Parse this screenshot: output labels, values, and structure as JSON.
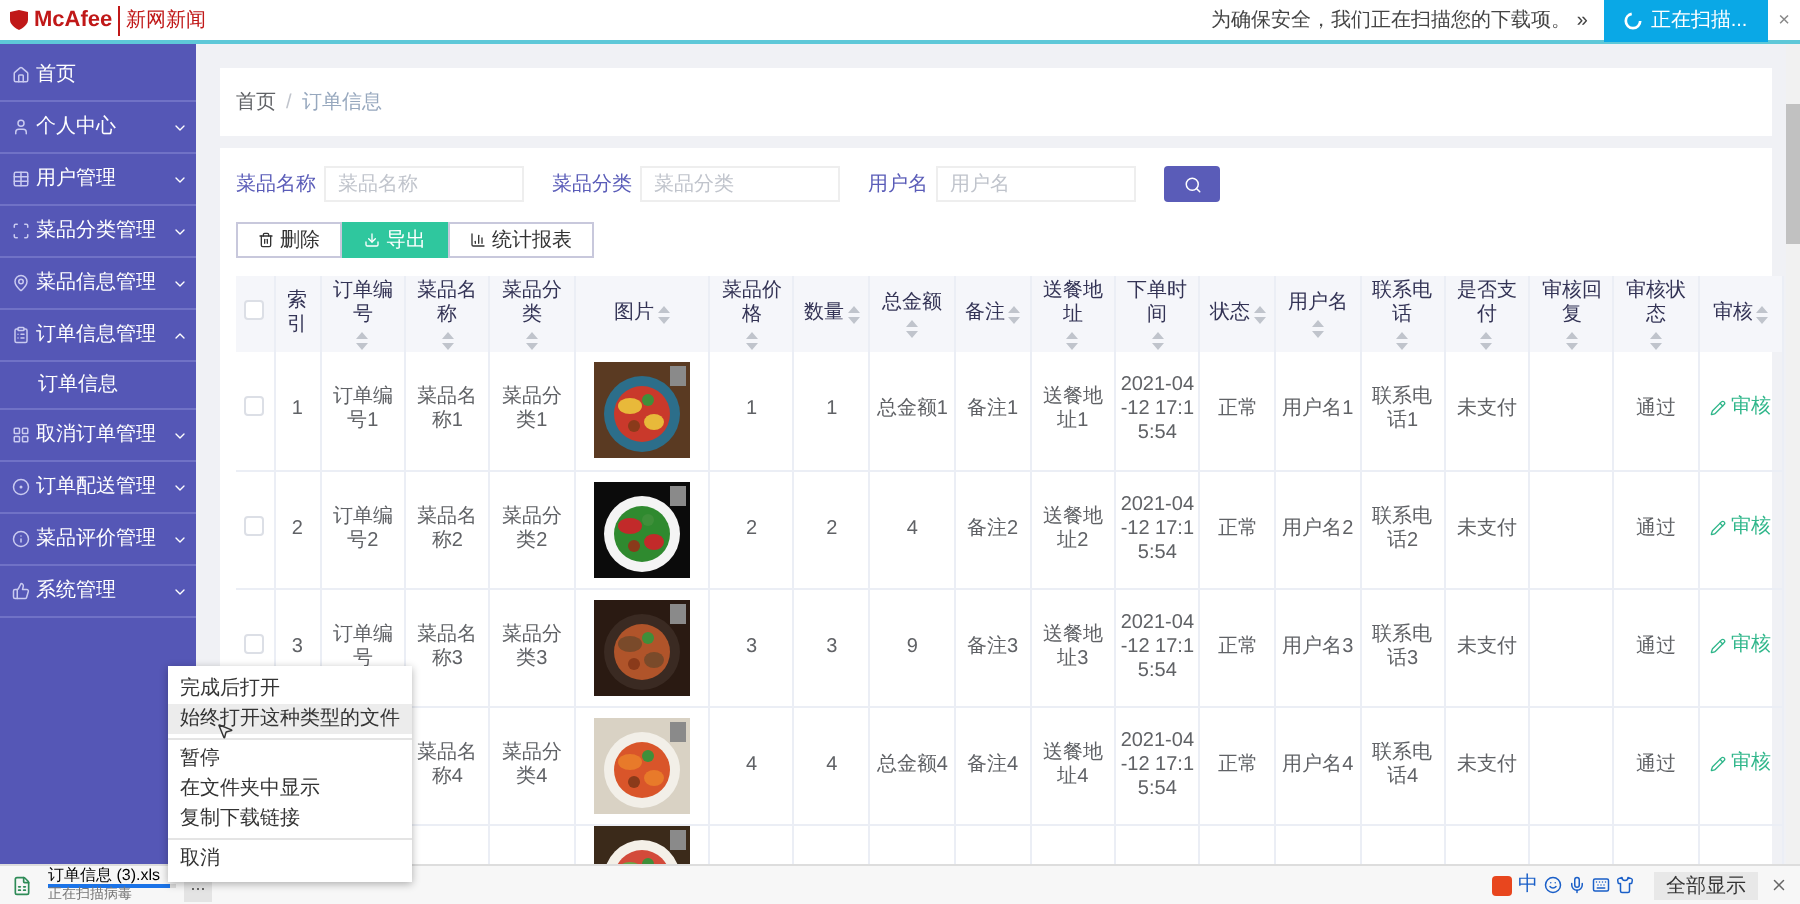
{
  "browser_banner": {
    "brand": "McAfee",
    "product": "新网新闻",
    "message": "为确保安全，我们正在扫描您的下载项。 »",
    "scan_button": "正在扫描...",
    "close": "×"
  },
  "sidebar": {
    "items": [
      {
        "kind": "link",
        "label": "首页"
      },
      {
        "kind": "group",
        "label": "个人中心",
        "expanded": false
      },
      {
        "kind": "group",
        "label": "用户管理",
        "expanded": false
      },
      {
        "kind": "group",
        "label": "菜品分类管理",
        "expanded": false
      },
      {
        "kind": "group",
        "label": "菜品信息管理",
        "expanded": false
      },
      {
        "kind": "group",
        "label": "订单信息管理",
        "expanded": true,
        "children": [
          {
            "label": "订单信息"
          }
        ]
      },
      {
        "kind": "group",
        "label": "取消订单管理",
        "expanded": false
      },
      {
        "kind": "group",
        "label": "订单配送管理",
        "expanded": false
      },
      {
        "kind": "group",
        "label": "菜品评价管理",
        "expanded": false
      },
      {
        "kind": "group",
        "label": "系统管理",
        "expanded": false
      }
    ]
  },
  "breadcrumb": {
    "items": [
      "首页",
      "订单信息"
    ],
    "separator": "/"
  },
  "search": {
    "fields": [
      {
        "label": "菜品名称",
        "placeholder": "菜品名称"
      },
      {
        "label": "菜品分类",
        "placeholder": "菜品分类"
      },
      {
        "label": "用户名",
        "placeholder": "用户名"
      }
    ]
  },
  "actions": [
    {
      "kind": "delete",
      "label": "删除"
    },
    {
      "kind": "export",
      "label": "导出"
    },
    {
      "kind": "report",
      "label": "统计报表"
    }
  ],
  "table": {
    "select_all_checked": false,
    "columns": [
      {
        "kind": "checkbox"
      },
      {
        "kind": "text",
        "label": "索引",
        "sortable": false
      },
      {
        "kind": "text",
        "label": "订单编号",
        "sortable": true
      },
      {
        "kind": "text",
        "label": "菜品名称",
        "sortable": true
      },
      {
        "kind": "text",
        "label": "菜品分类",
        "sortable": true
      },
      {
        "label": "图片",
        "sortable": true
      },
      {
        "kind": "text",
        "label": "菜品价格",
        "sortable": true
      },
      {
        "kind": "text",
        "label": "数量",
        "sortable": true
      },
      {
        "kind": "text",
        "label": "总金额",
        "sortable": true
      },
      {
        "kind": "text",
        "label": "备注",
        "sortable": true
      },
      {
        "kind": "text",
        "label": "送餐地址",
        "sortable": true
      },
      {
        "kind": "text",
        "label": "下单时间",
        "sortable": true
      },
      {
        "kind": "text",
        "label": "状态",
        "sortable": true
      },
      {
        "kind": "text",
        "label": "用户名",
        "sortable": true
      },
      {
        "kind": "text",
        "label": "联系电话",
        "sortable": true
      },
      {
        "kind": "text",
        "label": "是否支付",
        "sortable": true
      },
      {
        "kind": "blank",
        "label": "审核回复",
        "sortable": true
      },
      {
        "kind": "text",
        "label": "审核状态",
        "sortable": true
      },
      {
        "kind": "action",
        "label": "审核",
        "sortable": true
      }
    ],
    "rows": [
      {
        "kind": "full",
        "checked": false,
        "cells": [
          "1",
          "订单编号1",
          "菜品名称1",
          "菜品分类1",
          "1",
          "1",
          "总金额1",
          "备注1",
          "送餐地址1",
          "2021-04-12 17:15:54",
          "正常",
          "用户名1",
          "联系电话1",
          "未支付",
          "通过"
        ],
        "action": "审核"
      },
      {
        "kind": "full",
        "checked": false,
        "cells": [
          "2",
          "订单编号2",
          "菜品名称2",
          "菜品分类2",
          "2",
          "2",
          "4",
          "备注2",
          "送餐地址2",
          "2021-04-12 17:15:54",
          "正常",
          "用户名2",
          "联系电话2",
          "未支付",
          "通过"
        ],
        "action": "审核"
      },
      {
        "kind": "full",
        "checked": false,
        "cells": [
          "3",
          "订单编号",
          "菜品名称3",
          "菜品分类3",
          "3",
          "3",
          "9",
          "备注3",
          "送餐地址3",
          "2021-04-12 17:15:54",
          "正常",
          "用户名3",
          "联系电话3",
          "未支付",
          "通过"
        ],
        "action": "审核"
      },
      {
        "kind": "covered",
        "cells": [
          "菜品名称4",
          "菜品分类4",
          "4",
          "4",
          "总金额4",
          "备注4",
          "送餐地址4",
          "2021-04-12 17:15:54",
          "正常",
          "用户名4",
          "联系电话4",
          "未支付",
          "通过"
        ],
        "action": "审核"
      },
      {
        "kind": "partial"
      }
    ]
  },
  "context_menu": {
    "groups": [
      {
        "items": [
          {
            "label": "完成后打开",
            "selected": false
          },
          {
            "label": "始终打开这种类型的文件",
            "selected": true
          }
        ]
      },
      {
        "items": [
          {
            "label": "暂停",
            "selected": false
          },
          {
            "label": "在文件夹中显示",
            "selected": false
          },
          {
            "label": "复制下载链接",
            "selected": false
          }
        ]
      },
      {
        "items": [
          {
            "label": "取消",
            "selected": false
          }
        ]
      }
    ]
  },
  "download_bar": {
    "file": "订单信息 (3).xls",
    "status": "正在扫描病毒",
    "level": 0.95,
    "more": "...",
    "show_all": "全部显示"
  },
  "ime_toolbar": {
    "mode": "中"
  }
}
